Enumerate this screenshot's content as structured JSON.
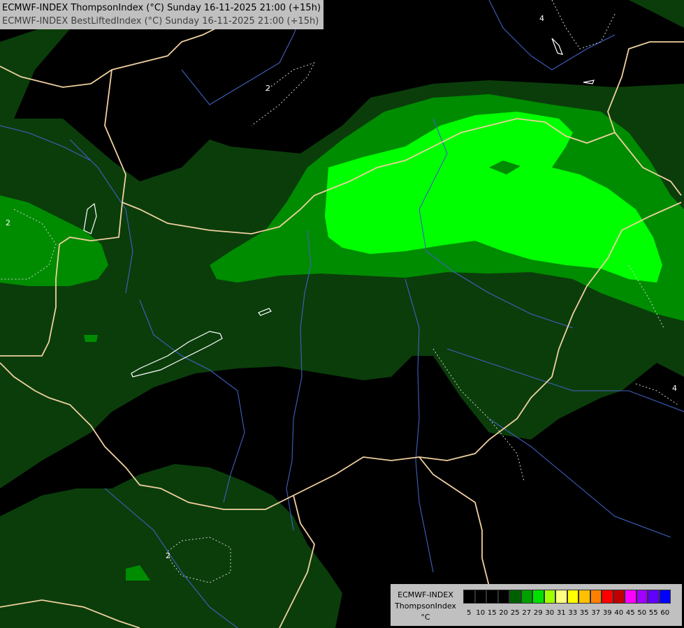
{
  "header": {
    "line1": "ECMWF-INDEX ThompsonIndex (°C) Sunday 16-11-2025 21:00 (+15h)",
    "line2": "ECMWF-INDEX BestLiftedIndex (°C) Sunday 16-11-2025 21:00 (+15h)"
  },
  "legend": {
    "title": "ECMWF-INDEX",
    "subtitle": "ThompsonIndex",
    "unit": "°C",
    "ticks": [
      "5",
      "10",
      "15",
      "20",
      "25",
      "27",
      "29",
      "30",
      "31",
      "33",
      "35",
      "37",
      "39",
      "40",
      "45",
      "50",
      "55",
      "60"
    ],
    "colors": [
      "#000000",
      "#000000",
      "#000000",
      "#000000",
      "#006000",
      "#00a000",
      "#00e000",
      "#a0ff00",
      "#ffff80",
      "#ffff00",
      "#ffc000",
      "#ff8000",
      "#ff0000",
      "#c00000",
      "#ff00ff",
      "#a000ff",
      "#6000ff",
      "#0000ff"
    ]
  },
  "contour_labels": [
    "2",
    "2",
    "2",
    "4",
    "4"
  ],
  "colors": {
    "fill_dark": "#0b3d0b",
    "fill_mid": "#008c00",
    "fill_bright": "#00ff00",
    "border": "#f0d0a0",
    "river": "#4060c0"
  }
}
